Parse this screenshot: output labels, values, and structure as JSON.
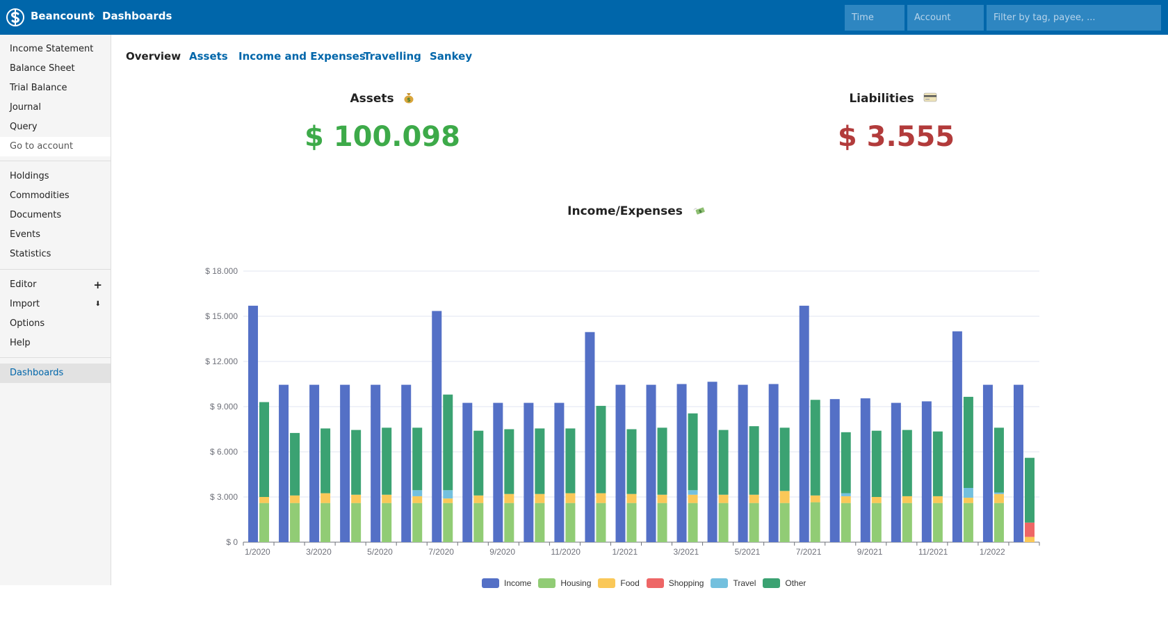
{
  "header": {
    "brand": "Beancount",
    "separator": "›",
    "crumb": "Dashboards",
    "time_placeholder": "Time",
    "account_placeholder": "Account",
    "filter_placeholder": "Filter by tag, payee, ..."
  },
  "sidebar": {
    "group1": [
      "Income Statement",
      "Balance Sheet",
      "Trial Balance",
      "Journal",
      "Query"
    ],
    "goto": "Go to account",
    "group2": [
      "Holdings",
      "Commodities",
      "Documents",
      "Events",
      "Statistics"
    ],
    "editor": "Editor",
    "editor_plus": "+",
    "import": "Import",
    "import_icon": "⬇",
    "options": "Options",
    "help": "Help",
    "dashboards": "Dashboards"
  },
  "tabs": [
    "Overview",
    "Assets",
    "Income and Expenses",
    "Travelling",
    "Sankey"
  ],
  "assets": {
    "title": "Assets",
    "value": "$ 100.098",
    "color": "#3daa49",
    "icon": "money-bag-icon"
  },
  "liabilities": {
    "title": "Liabilities",
    "value": "$ 3.555",
    "color": "#b23b3b",
    "icon": "credit-card-icon"
  },
  "income_expenses": {
    "title": "Income/Expenses",
    "icon": "money-wings-icon"
  },
  "chart_data": {
    "type": "bar",
    "title": "",
    "xlabel": "",
    "ylabel": "",
    "ylim": [
      0,
      18000
    ],
    "yticks": [
      0,
      3000,
      6000,
      9000,
      12000,
      15000,
      18000
    ],
    "ytick_labels": [
      "$ 0",
      "$ 3.000",
      "$ 6.000",
      "$ 9.000",
      "$ 12.000",
      "$ 15.000",
      "$ 18.000"
    ],
    "months": [
      "1/2020",
      "2/2020",
      "3/2020",
      "4/2020",
      "5/2020",
      "6/2020",
      "7/2020",
      "8/2020",
      "9/2020",
      "10/2020",
      "11/2020",
      "12/2020",
      "1/2021",
      "2/2021",
      "3/2021",
      "4/2021",
      "5/2021",
      "6/2021",
      "7/2021",
      "8/2021",
      "9/2021",
      "10/2021",
      "11/2021",
      "12/2021",
      "1/2022",
      "2/2022"
    ],
    "xtick_labels": [
      "1/2020",
      "3/2020",
      "5/2020",
      "7/2020",
      "9/2020",
      "11/2020",
      "1/2021",
      "3/2021",
      "5/2021",
      "7/2021",
      "9/2021",
      "11/2021",
      "1/2022"
    ],
    "income": [
      15700,
      10450,
      10450,
      10450,
      10450,
      10450,
      15350,
      9250,
      9250,
      9250,
      9250,
      13950,
      10450,
      10450,
      10500,
      10650,
      10450,
      10500,
      15700,
      9500,
      9550,
      9250,
      9350,
      14000,
      10450,
      10450
    ],
    "expense_series": [
      {
        "name": "Housing",
        "color": "#91cc75",
        "values": [
          2600,
          2600,
          2600,
          2600,
          2600,
          2600,
          2600,
          2600,
          2600,
          2600,
          2600,
          2600,
          2600,
          2600,
          2600,
          2600,
          2600,
          2600,
          2650,
          2600,
          2600,
          2600,
          2600,
          2600,
          2600,
          0
        ]
      },
      {
        "name": "Food",
        "color": "#fac858",
        "values": [
          400,
          500,
          650,
          550,
          550,
          450,
          300,
          500,
          600,
          600,
          650,
          650,
          600,
          550,
          550,
          550,
          550,
          800,
          450,
          450,
          400,
          450,
          450,
          350,
          600,
          350
        ]
      },
      {
        "name": "Shopping",
        "color": "#ee6666",
        "values": [
          0,
          0,
          0,
          0,
          0,
          0,
          0,
          0,
          0,
          0,
          0,
          0,
          0,
          0,
          0,
          0,
          0,
          0,
          0,
          0,
          0,
          0,
          0,
          0,
          0,
          950
        ]
      },
      {
        "name": "Travel",
        "color": "#73c0de",
        "values": [
          0,
          0,
          0,
          0,
          0,
          400,
          550,
          0,
          0,
          0,
          0,
          0,
          0,
          0,
          300,
          0,
          0,
          0,
          0,
          200,
          0,
          0,
          0,
          650,
          100,
          0
        ]
      },
      {
        "name": "Other",
        "color": "#3ba272",
        "values": [
          6300,
          4150,
          4300,
          4300,
          4450,
          4150,
          6350,
          4300,
          4300,
          4350,
          4300,
          5800,
          4300,
          4450,
          5100,
          4300,
          4550,
          4200,
          6350,
          4050,
          4400,
          4400,
          4300,
          6050,
          4300,
          4300
        ]
      }
    ],
    "income_color": "#5470c6",
    "legend": [
      "Income",
      "Housing",
      "Food",
      "Shopping",
      "Travel",
      "Other"
    ],
    "legend_colors": [
      "#5470c6",
      "#91cc75",
      "#fac858",
      "#ee6666",
      "#73c0de",
      "#3ba272"
    ],
    "legend_position": "bottom-center",
    "grid": true
  }
}
